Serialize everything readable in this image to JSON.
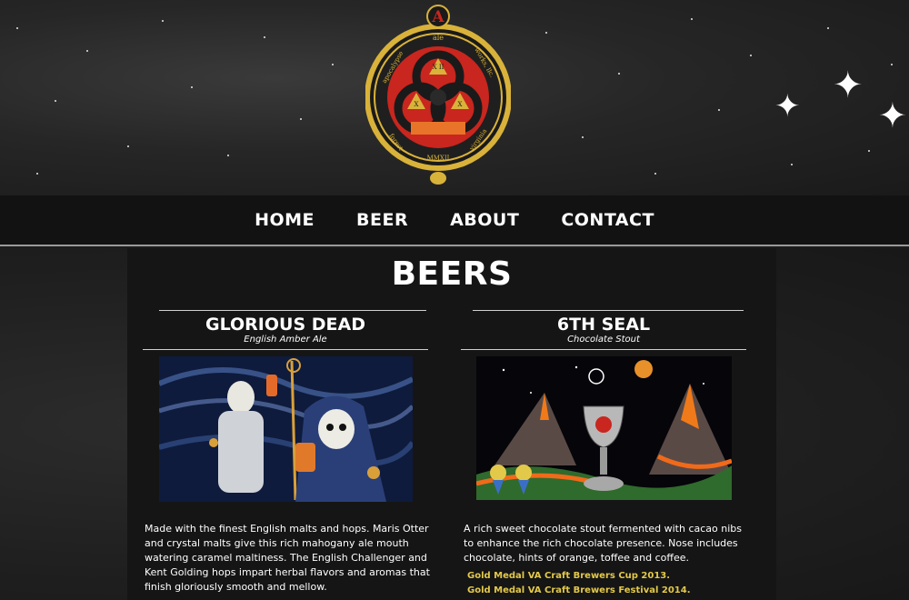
{
  "brand": {
    "logo_letter": "A",
    "logo_top_word": "ale",
    "logo_left_text": "apocalypse",
    "logo_right_text": "works, llc.",
    "logo_bottom_left": "forest",
    "logo_bottom_right": "virginia",
    "logo_year": "MMXII",
    "logo_center_top": "X II",
    "logo_center_left": "X",
    "logo_center_right": "X"
  },
  "nav": {
    "items": [
      {
        "label": "HOME"
      },
      {
        "label": "BEER"
      },
      {
        "label": "ABOUT"
      },
      {
        "label": "CONTACT"
      }
    ]
  },
  "page": {
    "title": "BEERS"
  },
  "beers": [
    {
      "name": "GLORIOUS DEAD",
      "style": "English Amber Ale",
      "description": " Made with the finest English malts and hops.   Maris Otter and crystal malts give this rich mahogany ale mouth watering caramel maltiness.  The English Challenger and Kent Golding hops impart herbal flavors and aromas that finish gloriously smooth and mellow.",
      "awards": []
    },
    {
      "name": "6TH SEAL",
      "style": "Chocolate Stout",
      "description": " A rich sweet chocolate stout fermented with cacao nibs to enhance the rich chocolate presence.   Nose includes chocolate, hints of orange, toffee and coffee.",
      "awards": [
        {
          "text": "Gold Medal VA Craft Brewers Cup 2013."
        },
        {
          "text": "Gold Medal VA Craft Brewers Festival 2014."
        }
      ]
    }
  ],
  "colors": {
    "award_gold": "#e3c94a",
    "emblem_red": "#c8261e",
    "emblem_gold": "#d9b23a"
  }
}
